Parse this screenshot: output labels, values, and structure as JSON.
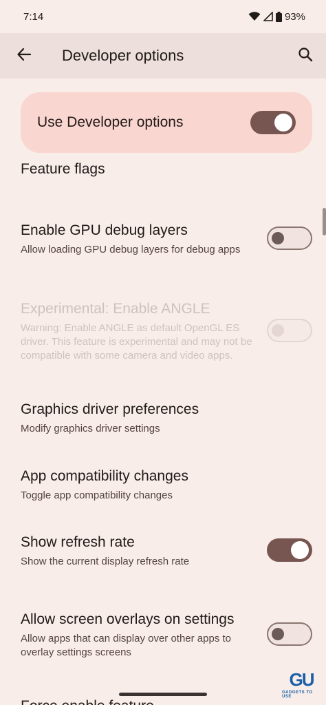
{
  "status_bar": {
    "time": "7:14",
    "battery": "93%"
  },
  "app_bar": {
    "title": "Developer options"
  },
  "master_toggle": {
    "label": "Use Developer options",
    "on": true
  },
  "section": {
    "title": "Feature flags"
  },
  "settings": [
    {
      "title": "Enable GPU debug layers",
      "summary": "Allow loading GPU debug layers for debug apps",
      "toggle": "off"
    },
    {
      "title": "Experimental: Enable ANGLE",
      "summary": "Warning: Enable ANGLE as default OpenGL ES driver. This feature is experimental and may not be compatible with some camera and video apps.",
      "toggle": "disabled"
    },
    {
      "title": "Graphics driver preferences",
      "summary": "Modify graphics driver settings"
    },
    {
      "title": "App compatibility changes",
      "summary": "Toggle app compatibility changes"
    },
    {
      "title": "Show refresh rate",
      "summary": "Show the current display refresh rate",
      "toggle": "on"
    },
    {
      "title": "Allow screen overlays on settings",
      "summary": "Allow apps that can display over other apps to overlay settings screens",
      "toggle": "off"
    }
  ],
  "partial_next": "Force enable feature",
  "watermark": {
    "logo": "GU",
    "text": "GADGETS TO USE"
  },
  "colors": {
    "background": "#f8ede9",
    "accent": "#775652",
    "highlight": "#f9d6d0"
  }
}
